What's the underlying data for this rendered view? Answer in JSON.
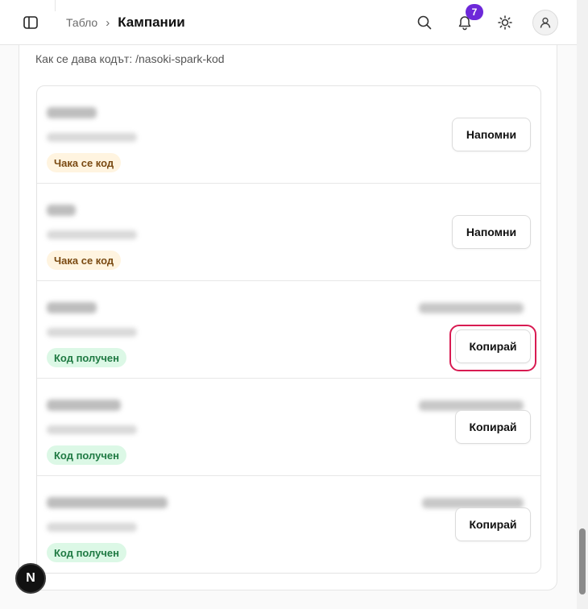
{
  "header": {
    "breadcrumb_parent": "Табло",
    "breadcrumb_separator": "›",
    "breadcrumb_current": "Кампании",
    "notification_count": "7",
    "icons": [
      "sidebar-toggle-icon",
      "search-icon",
      "bell-icon",
      "sun-icon",
      "user-icon"
    ]
  },
  "campaign": {
    "howto_text": "Как се дава кодът: /nasoki-spark-kod"
  },
  "rows": [
    {
      "status": "Чака се код",
      "status_kind": "pending",
      "action": "Напомни"
    },
    {
      "status": "Чака се код",
      "status_kind": "pending",
      "action": "Напомни"
    },
    {
      "status": "Код получен",
      "status_kind": "received",
      "action": "Копирай"
    },
    {
      "status": "Код получен",
      "status_kind": "received",
      "action": "Копирай"
    },
    {
      "status": "Код получен",
      "status_kind": "received",
      "action": "Копирай"
    }
  ],
  "dev_badge": "N",
  "colors": {
    "accent": "#6d28d9",
    "focus_ring": "#d81b52",
    "pending_bg": "#fff4e0",
    "pending_text": "#7a4a12",
    "received_bg": "#dcf8e6",
    "received_text": "#1f7a43"
  }
}
